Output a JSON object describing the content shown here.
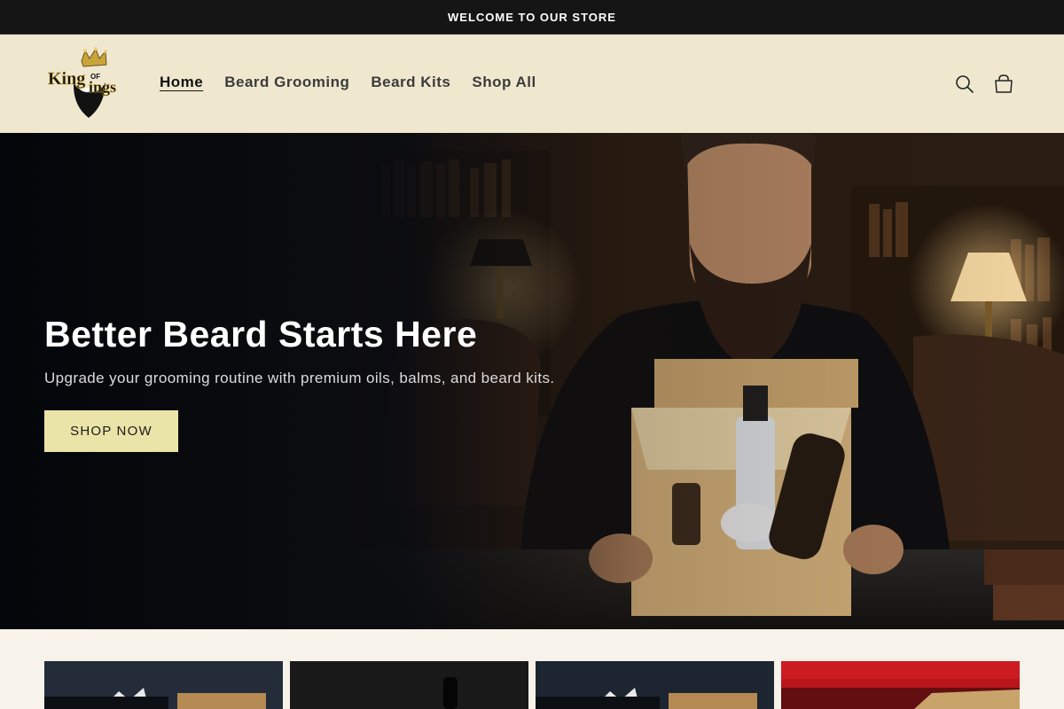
{
  "announcement": {
    "text": "WELCOME TO OUR STORE"
  },
  "header": {
    "logo": {
      "brand_text": "King of Kings",
      "icon": "crown-beard-logo"
    },
    "nav": [
      {
        "label": "Home",
        "active": true
      },
      {
        "label": "Beard Grooming",
        "active": false
      },
      {
        "label": "Beard Kits",
        "active": false
      },
      {
        "label": "Shop All",
        "active": false
      }
    ],
    "icons": [
      "search-icon",
      "cart-icon"
    ]
  },
  "hero": {
    "title": "Better Beard Starts Here",
    "subtitle": "Upgrade your grooming routine with premium oils, balms, and beard kits.",
    "cta_label": "SHOP NOW"
  },
  "product_cards": [
    {
      "image": "beard-kit-box"
    },
    {
      "image": "beard-oil-bottle"
    },
    {
      "image": "beard-kit-box"
    },
    {
      "image": "wooden-box-red-background"
    }
  ],
  "colors": {
    "announcement_bg": "#151515",
    "header_bg": "#efe8cf",
    "cta_bg": "#ebe4a8",
    "page_bg": "#f7f2ea"
  }
}
